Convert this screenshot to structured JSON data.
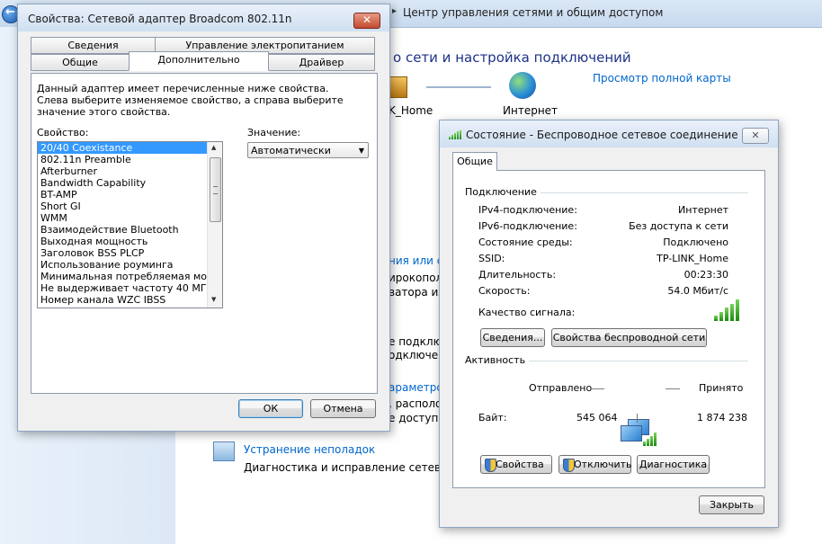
{
  "background": {
    "breadcrumb": "Центр управления сетями и общим доступом",
    "heading": "о сети и настройка подключений",
    "map_link": "Просмотр полной карты",
    "home_label": "K_Home",
    "internet_label": "Интернет",
    "fragments": {
      "f1": "ния или се",
      "f2": "ирокопол",
      "f3": "ватора или",
      "f4": "е подклю",
      "f5": "одключени",
      "f6": "араметро",
      "f7": ", располо",
      "f8": "е доступа"
    },
    "troubleshoot_link": "Устранение неполадок",
    "troubleshoot_desc": "Диагностика и исправление сетевых пр"
  },
  "properties_dialog": {
    "title": "Свойства: Сетевой адаптер Broadcom 802.11n",
    "tabs_row1": [
      "Сведения",
      "Управление электропитанием"
    ],
    "tabs_row2": [
      "Общие",
      "Дополнительно",
      "Драйвер"
    ],
    "active_tab": "Дополнительно",
    "description": "Данный адаптер имеет перечисленные ниже свойства. Слева выберите изменяемое свойство, а справа выберите значение этого свойства.",
    "property_label": "Свойство:",
    "value_label": "Значение:",
    "properties": [
      "20/40 Coexistance",
      "802.11n Preamble",
      "Afterburner",
      "Bandwidth Capability",
      "BT-AMP",
      "Short GI",
      "WMM",
      "Взаимодействие Bluetooth",
      "Выходная мощность",
      "Заголовок BSS PLCP",
      "Использование роуминга",
      "Минимальная потребляемая мощно",
      "Не выдерживает частоту 40 МГц",
      "Номер канала WZC IBSS"
    ],
    "selected_property": "20/40 Coexistance",
    "value": "Автоматически",
    "ok_label": "ОК",
    "cancel_label": "Отмена"
  },
  "status_dialog": {
    "title": "Состояние - Беспроводное сетевое соединение",
    "tab": "Общие",
    "connection_group": "Подключение",
    "rows": [
      {
        "label": "IPv4-подключение:",
        "value": "Интернет"
      },
      {
        "label": "IPv6-подключение:",
        "value": "Без доступа к сети"
      },
      {
        "label": "Состояние среды:",
        "value": "Подключено"
      },
      {
        "label": "SSID:",
        "value": "TP-LINK_Home"
      },
      {
        "label": "Длительность:",
        "value": "00:23:30"
      },
      {
        "label": "Скорость:",
        "value": "54.0 Мбит/с"
      }
    ],
    "signal_label": "Качество сигнала:",
    "signal_bars": 5,
    "details_button": "Сведения...",
    "wireless_props_button": "Свойства беспроводной сети",
    "activity_group": "Активность",
    "sent_label": "Отправлено",
    "received_label": "Принято",
    "bytes_label": "Байт:",
    "bytes_sent": "545 064",
    "bytes_received": "1 874 238",
    "properties_button": "Свойства",
    "disable_button": "Отключить",
    "diagnostics_button": "Диагностика",
    "close_button": "Закрыть"
  }
}
